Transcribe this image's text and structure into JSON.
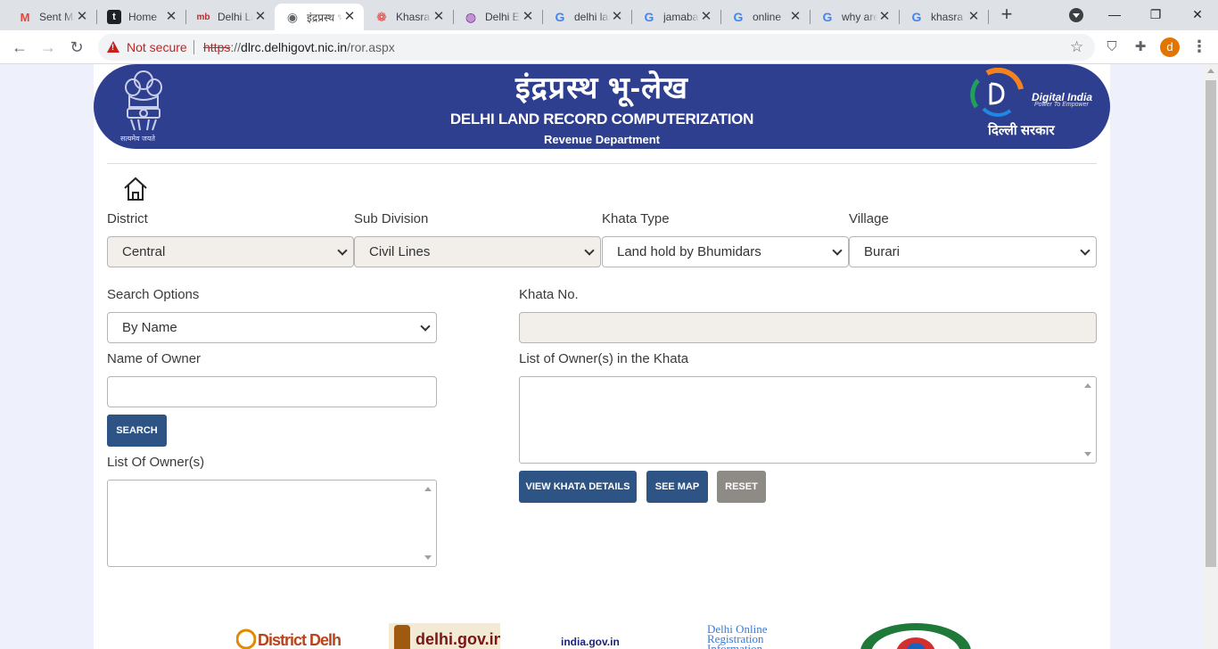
{
  "browser": {
    "tabs": [
      {
        "title": "Sent Mail",
        "icon": "gmail-icon"
      },
      {
        "title": "Home",
        "icon": "t-icon"
      },
      {
        "title": "Delhi Land",
        "icon": "mb-icon"
      },
      {
        "title": "इंद्रप्रस्थ भू-लेख",
        "icon": "globe-icon"
      },
      {
        "title": "Khasra",
        "icon": "cluster-icon"
      },
      {
        "title": "Delhi E",
        "icon": "swirl-icon"
      },
      {
        "title": "delhi land",
        "icon": "google-icon"
      },
      {
        "title": "jamabandi",
        "icon": "google-icon"
      },
      {
        "title": "online",
        "icon": "google-icon"
      },
      {
        "title": "why are",
        "icon": "google-icon"
      },
      {
        "title": "khasra",
        "icon": "google-icon"
      }
    ],
    "address": {
      "security_label": "Not secure",
      "scheme": "https",
      "rest_prefix": "://",
      "host": "dlrc.delhigovt.nic.in",
      "path": "/ror.aspx"
    },
    "profile_initial": "d"
  },
  "header": {
    "title_hindi": "इंद्रप्रस्थ भू-लेख",
    "title_en": "DELHI LAND RECORD COMPUTERIZATION",
    "department": "Revenue Department",
    "emblem_caption": "सत्यमेव जयते",
    "digital_india": "Digital India",
    "digital_india_tagline": "Power To Empower",
    "delhi_sarkar": "दिल्ली सरकार"
  },
  "form": {
    "district": {
      "label": "District",
      "value": "Central"
    },
    "sub_division": {
      "label": "Sub Division",
      "value": "Civil Lines"
    },
    "khata_type": {
      "label": "Khata Type",
      "value": "Land hold by Bhumidars"
    },
    "village": {
      "label": "Village",
      "value": "Burari"
    },
    "search_options": {
      "label": "Search Options",
      "value": "By Name"
    },
    "khata_no": {
      "label": "Khata No.",
      "value": ""
    },
    "owner_name": {
      "label": "Name of Owner",
      "value": ""
    },
    "owners_in_khata": {
      "label": "List of Owner(s) in the Khata"
    },
    "owner_list": {
      "label": "List Of Owner(s)"
    },
    "buttons": {
      "search": "SEARCH",
      "view_khata": "VIEW KHATA DETAILS",
      "see_map": "SEE MAP",
      "reset": "RESET"
    }
  },
  "footer": {
    "logos": [
      "District Delhi",
      "delhi.gov.in",
      "india.gov.in",
      "Delhi Online Registration Information"
    ]
  },
  "colors": {
    "banner": "#2e3f8f",
    "button_primary": "#2e5486",
    "button_reset": "#8e8a85",
    "page_bg": "#eef1fb"
  }
}
